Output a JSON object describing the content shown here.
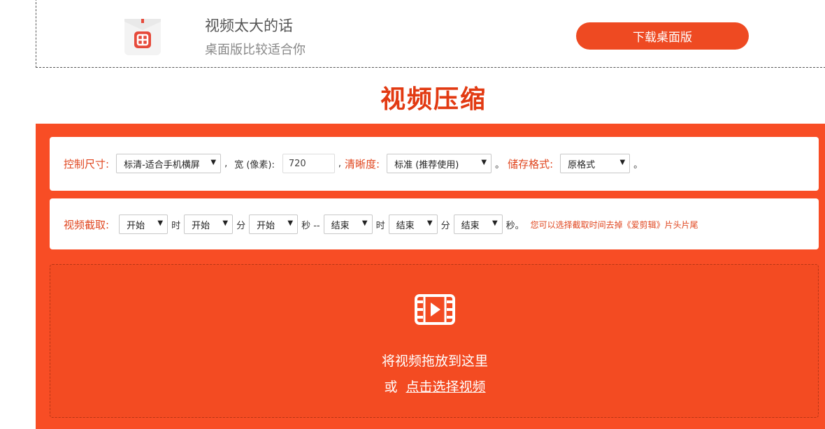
{
  "banner": {
    "title": "视频太大的话",
    "subtitle": "桌面版比较适合你",
    "download_label": "下载桌面版"
  },
  "page_title": "视频压缩",
  "settings": {
    "size_label": "控制尺寸:",
    "size_value": "标清-适合手机横屏",
    "width_label": "宽 (像素):",
    "width_value": "720",
    "comma": ",",
    "clarity_label": "清晰度:",
    "clarity_value": "标准 (推荐使用)",
    "period": "。",
    "format_label": "储存格式:",
    "format_value": "原格式"
  },
  "clip": {
    "label": "视频截取:",
    "start_hour": "开始",
    "hour_unit": "时",
    "start_min": "开始",
    "min_unit": "分",
    "start_sec": "开始",
    "sec_unit_dash": "秒 --",
    "end_hour": "结束",
    "end_min": "结束",
    "end_sec": "结束",
    "sec_unit_end": "秒。",
    "tip": "您可以选择截取时间去掉《爱剪辑》片头片尾"
  },
  "dropzone": {
    "main_text": "将视频拖放到这里",
    "or_text": "或",
    "select_link": "点击选择视频"
  },
  "colors": {
    "accent": "#f84d25",
    "button": "#ee4a22",
    "title": "#e23a12"
  },
  "icons": {
    "app": "app-logo-icon",
    "film": "film-play-icon",
    "dropdown": "dropdown-arrow-icon"
  }
}
